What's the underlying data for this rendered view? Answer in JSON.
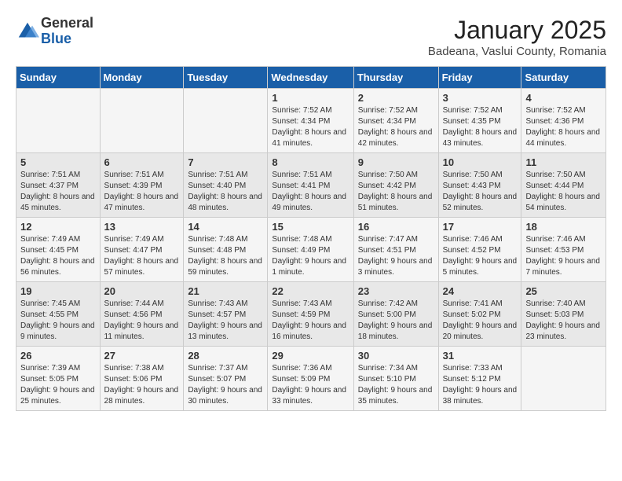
{
  "logo": {
    "general": "General",
    "blue": "Blue"
  },
  "title": "January 2025",
  "subtitle": "Badeana, Vaslui County, Romania",
  "days_of_week": [
    "Sunday",
    "Monday",
    "Tuesday",
    "Wednesday",
    "Thursday",
    "Friday",
    "Saturday"
  ],
  "weeks": [
    [
      {
        "day": "",
        "info": ""
      },
      {
        "day": "",
        "info": ""
      },
      {
        "day": "",
        "info": ""
      },
      {
        "day": "1",
        "info": "Sunrise: 7:52 AM\nSunset: 4:34 PM\nDaylight: 8 hours and 41 minutes."
      },
      {
        "day": "2",
        "info": "Sunrise: 7:52 AM\nSunset: 4:34 PM\nDaylight: 8 hours and 42 minutes."
      },
      {
        "day": "3",
        "info": "Sunrise: 7:52 AM\nSunset: 4:35 PM\nDaylight: 8 hours and 43 minutes."
      },
      {
        "day": "4",
        "info": "Sunrise: 7:52 AM\nSunset: 4:36 PM\nDaylight: 8 hours and 44 minutes."
      }
    ],
    [
      {
        "day": "5",
        "info": "Sunrise: 7:51 AM\nSunset: 4:37 PM\nDaylight: 8 hours and 45 minutes."
      },
      {
        "day": "6",
        "info": "Sunrise: 7:51 AM\nSunset: 4:39 PM\nDaylight: 8 hours and 47 minutes."
      },
      {
        "day": "7",
        "info": "Sunrise: 7:51 AM\nSunset: 4:40 PM\nDaylight: 8 hours and 48 minutes."
      },
      {
        "day": "8",
        "info": "Sunrise: 7:51 AM\nSunset: 4:41 PM\nDaylight: 8 hours and 49 minutes."
      },
      {
        "day": "9",
        "info": "Sunrise: 7:50 AM\nSunset: 4:42 PM\nDaylight: 8 hours and 51 minutes."
      },
      {
        "day": "10",
        "info": "Sunrise: 7:50 AM\nSunset: 4:43 PM\nDaylight: 8 hours and 52 minutes."
      },
      {
        "day": "11",
        "info": "Sunrise: 7:50 AM\nSunset: 4:44 PM\nDaylight: 8 hours and 54 minutes."
      }
    ],
    [
      {
        "day": "12",
        "info": "Sunrise: 7:49 AM\nSunset: 4:45 PM\nDaylight: 8 hours and 56 minutes."
      },
      {
        "day": "13",
        "info": "Sunrise: 7:49 AM\nSunset: 4:47 PM\nDaylight: 8 hours and 57 minutes."
      },
      {
        "day": "14",
        "info": "Sunrise: 7:48 AM\nSunset: 4:48 PM\nDaylight: 8 hours and 59 minutes."
      },
      {
        "day": "15",
        "info": "Sunrise: 7:48 AM\nSunset: 4:49 PM\nDaylight: 9 hours and 1 minute."
      },
      {
        "day": "16",
        "info": "Sunrise: 7:47 AM\nSunset: 4:51 PM\nDaylight: 9 hours and 3 minutes."
      },
      {
        "day": "17",
        "info": "Sunrise: 7:46 AM\nSunset: 4:52 PM\nDaylight: 9 hours and 5 minutes."
      },
      {
        "day": "18",
        "info": "Sunrise: 7:46 AM\nSunset: 4:53 PM\nDaylight: 9 hours and 7 minutes."
      }
    ],
    [
      {
        "day": "19",
        "info": "Sunrise: 7:45 AM\nSunset: 4:55 PM\nDaylight: 9 hours and 9 minutes."
      },
      {
        "day": "20",
        "info": "Sunrise: 7:44 AM\nSunset: 4:56 PM\nDaylight: 9 hours and 11 minutes."
      },
      {
        "day": "21",
        "info": "Sunrise: 7:43 AM\nSunset: 4:57 PM\nDaylight: 9 hours and 13 minutes."
      },
      {
        "day": "22",
        "info": "Sunrise: 7:43 AM\nSunset: 4:59 PM\nDaylight: 9 hours and 16 minutes."
      },
      {
        "day": "23",
        "info": "Sunrise: 7:42 AM\nSunset: 5:00 PM\nDaylight: 9 hours and 18 minutes."
      },
      {
        "day": "24",
        "info": "Sunrise: 7:41 AM\nSunset: 5:02 PM\nDaylight: 9 hours and 20 minutes."
      },
      {
        "day": "25",
        "info": "Sunrise: 7:40 AM\nSunset: 5:03 PM\nDaylight: 9 hours and 23 minutes."
      }
    ],
    [
      {
        "day": "26",
        "info": "Sunrise: 7:39 AM\nSunset: 5:05 PM\nDaylight: 9 hours and 25 minutes."
      },
      {
        "day": "27",
        "info": "Sunrise: 7:38 AM\nSunset: 5:06 PM\nDaylight: 9 hours and 28 minutes."
      },
      {
        "day": "28",
        "info": "Sunrise: 7:37 AM\nSunset: 5:07 PM\nDaylight: 9 hours and 30 minutes."
      },
      {
        "day": "29",
        "info": "Sunrise: 7:36 AM\nSunset: 5:09 PM\nDaylight: 9 hours and 33 minutes."
      },
      {
        "day": "30",
        "info": "Sunrise: 7:34 AM\nSunset: 5:10 PM\nDaylight: 9 hours and 35 minutes."
      },
      {
        "day": "31",
        "info": "Sunrise: 7:33 AM\nSunset: 5:12 PM\nDaylight: 9 hours and 38 minutes."
      },
      {
        "day": "",
        "info": ""
      }
    ]
  ]
}
